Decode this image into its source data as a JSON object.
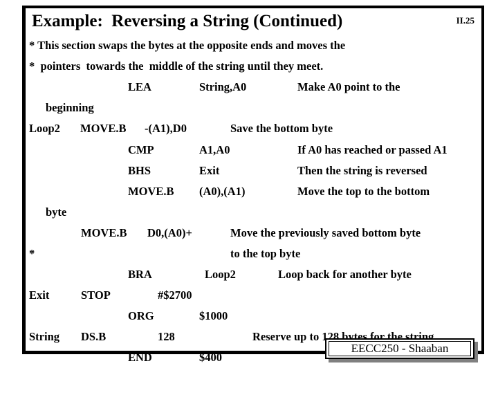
{
  "slide": {
    "title": "Example:  Reversing a String (Continued)",
    "number": "II.25"
  },
  "footer": {
    "badge_text": "EECC250 - Shaaban"
  },
  "colors": {
    "background": "#ffffff",
    "text": "#000000",
    "frame": "#000000",
    "badge_shadow": "#808080",
    "badge_fill": "#ffffff"
  },
  "code": {
    "header_lines": [
      "* This section swaps the bytes at the opposite ends and moves the",
      "*  pointers  towards the  middle of the string until they meet."
    ],
    "lines": [
      {
        "label": "",
        "opcode": "LEA",
        "operand": "String,A0",
        "comment": "Make A0 point to the"
      },
      {
        "continuation": "beginning"
      },
      {
        "label": "Loop2",
        "opcode": "MOVE.B",
        "operand": "-(A1),D0",
        "comment": "Save the bottom byte"
      },
      {
        "label": "",
        "opcode": "CMP",
        "operand": "A1,A0",
        "comment": "If A0 has reached or passed A1"
      },
      {
        "label": "",
        "opcode": "BHS",
        "operand": "Exit",
        "comment": "Then the string is reversed"
      },
      {
        "label": "",
        "opcode": "MOVE.B",
        "operand": "(A0),(A1)",
        "comment": "Move the top to the bottom"
      },
      {
        "continuation": "byte"
      },
      {
        "label": "",
        "opcode": "MOVE.B",
        "operand": "D0,(A0)+",
        "comment": "Move the previously saved bottom byte"
      },
      {
        "star": "*",
        "comment": "to the top byte"
      },
      {
        "label": "",
        "opcode": "BRA",
        "operand": "Loop2",
        "comment": "Loop back for another byte"
      },
      {
        "label": "Exit",
        "opcode": "STOP",
        "operand": "#$2700",
        "comment": ""
      },
      {
        "label": "",
        "opcode": "ORG",
        "operand": "$1000",
        "comment": ""
      },
      {
        "label": "String",
        "opcode": "DS.B",
        "operand": "128",
        "comment": "Reserve up to 128 bytes for the string"
      },
      {
        "label": "",
        "opcode": "END",
        "operand": "$400",
        "comment": ""
      }
    ]
  }
}
